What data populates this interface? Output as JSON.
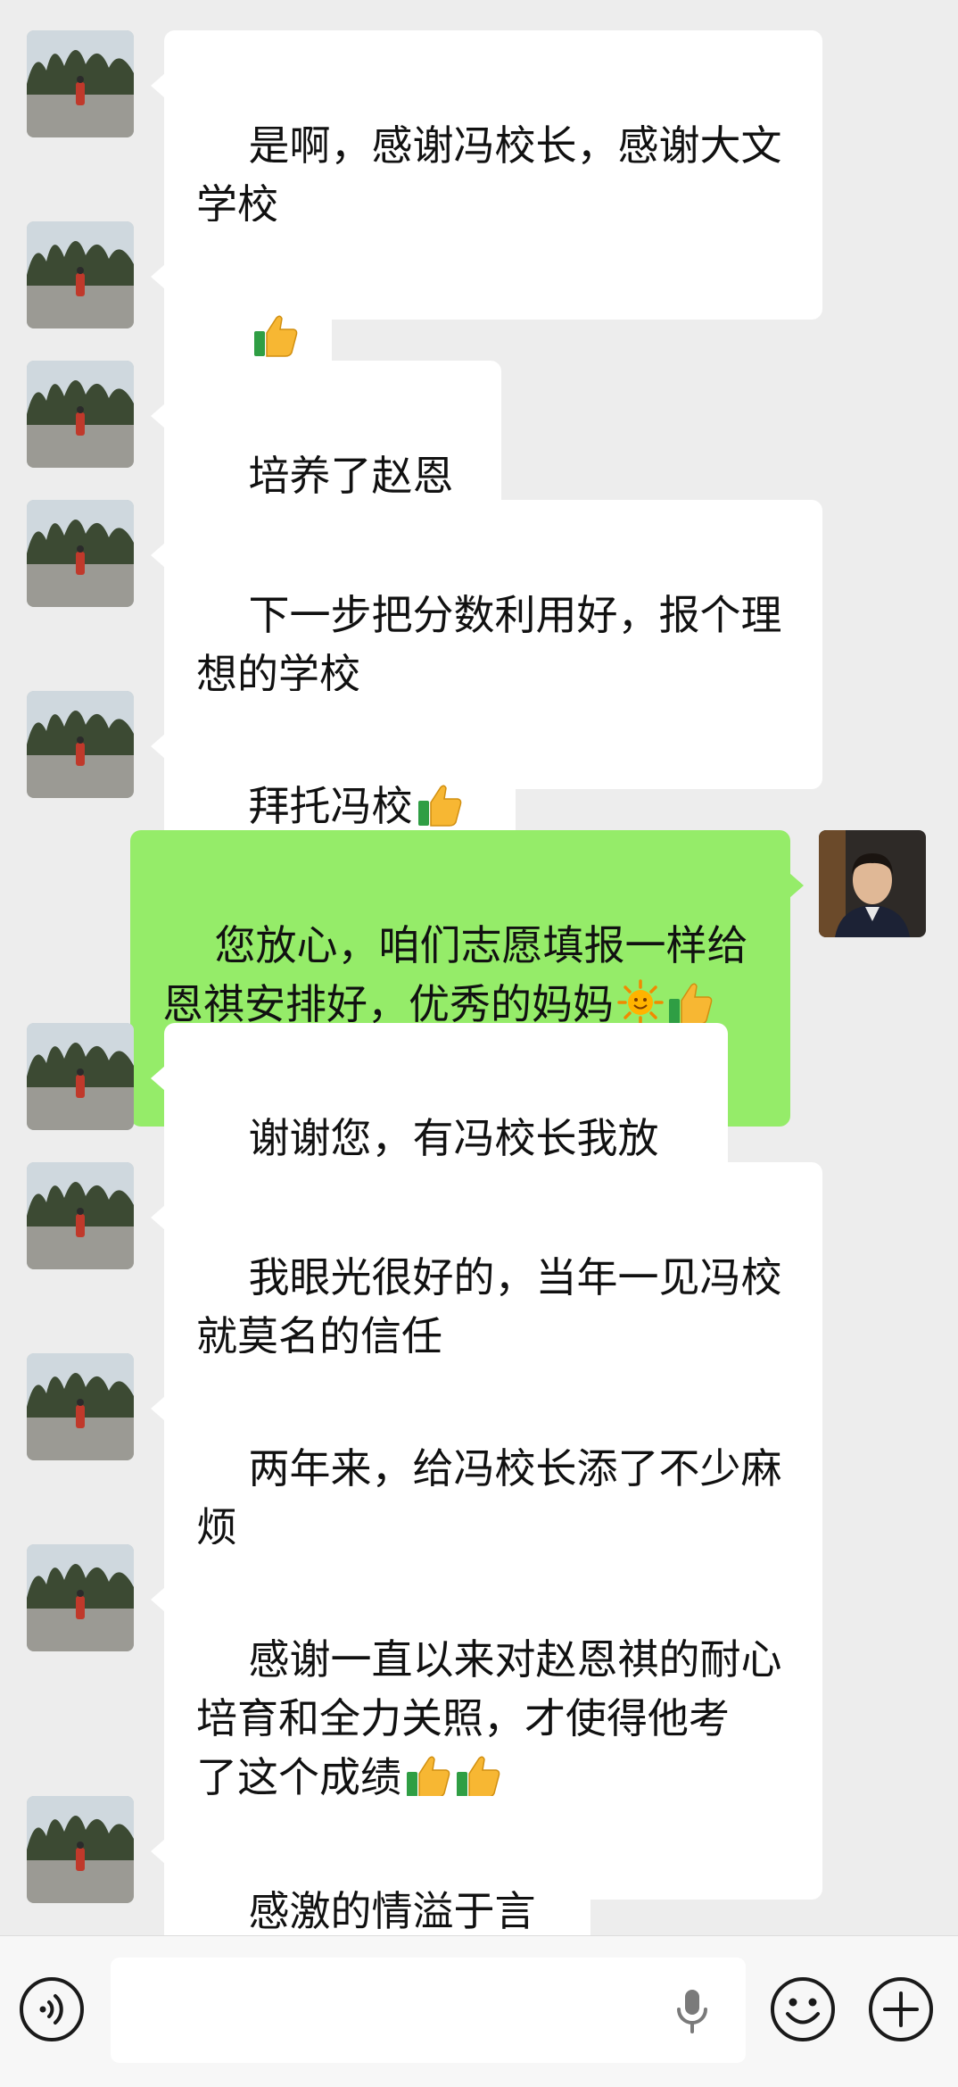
{
  "messages": [
    {
      "from": "other",
      "text": "是啊，感谢冯校长，感谢大文\n学校",
      "emoji": []
    },
    {
      "from": "other",
      "text": "",
      "emoji": [
        "thumbs-up",
        "thumbs-up"
      ]
    },
    {
      "from": "other",
      "text": "培养了赵恩祺",
      "emoji": []
    },
    {
      "from": "other",
      "text": "下一步把分数利用好，报个理\n想的学校",
      "emoji": []
    },
    {
      "from": "other",
      "text": "拜托冯校",
      "emoji": [
        "thumbs-up",
        "thumbs-up"
      ]
    },
    {
      "from": "me",
      "text": "您放心，咱们志愿填报一样给\n恩祺安排好，优秀的妈妈",
      "emoji": [
        "sun",
        "thumbs-up"
      ]
    },
    {
      "from": "other",
      "text": "谢谢您，有冯校长我放心",
      "emoji": []
    },
    {
      "from": "other",
      "text": "我眼光很好的，当年一见冯校\n就莫名的信任",
      "emoji": []
    },
    {
      "from": "other",
      "text": "两年来，给冯校长添了不少麻\n烦",
      "emoji": []
    },
    {
      "from": "other",
      "text": "感谢一直以来对赵恩祺的耐心\n培育和全力关照，才使得他考\n了这个成绩",
      "emoji": [
        "thumbs-up",
        "thumbs-up"
      ]
    },
    {
      "from": "other",
      "text": "感激的情溢于言表",
      "emoji": []
    }
  ],
  "colors": {
    "background": "#ededed",
    "incoming_bubble": "#ffffff",
    "outgoing_bubble": "#95ec69"
  },
  "input_bar": {
    "icons": [
      "voice-icon",
      "microphone-icon",
      "emoji-icon",
      "plus-icon"
    ]
  }
}
